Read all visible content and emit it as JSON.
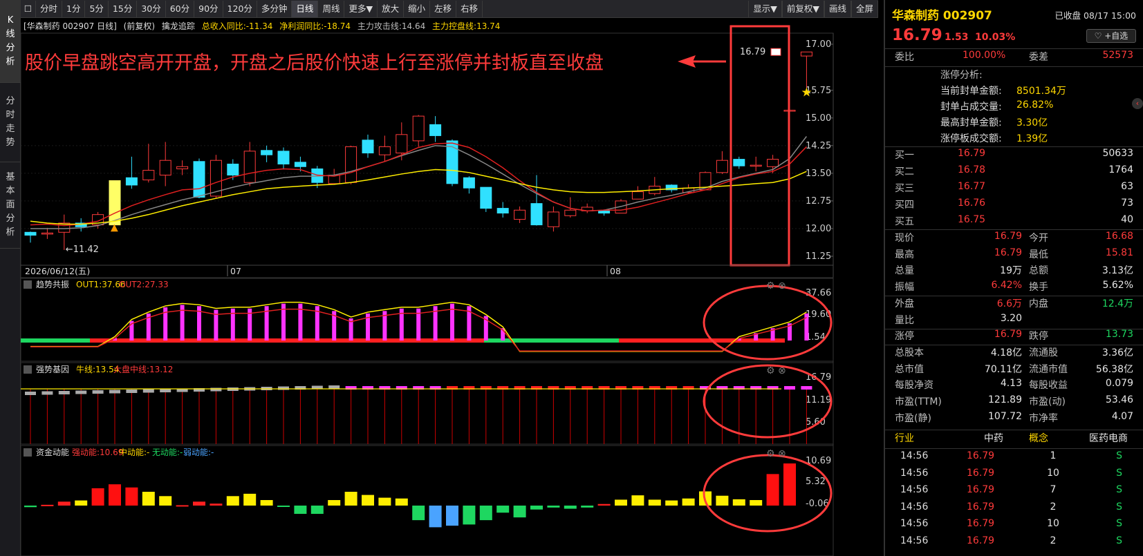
{
  "left_tabs": [
    {
      "chars": [
        "K",
        "线",
        "分",
        "析"
      ],
      "active": true
    },
    {
      "chars": [
        "分",
        "时",
        "走",
        "势"
      ],
      "active": false
    },
    {
      "chars": [
        "基",
        "本",
        "面",
        "分",
        "析"
      ],
      "active": false
    }
  ],
  "toolbar": {
    "left": [
      "分时",
      "1分",
      "5分",
      "15分",
      "30分",
      "60分",
      "90分",
      "120分",
      "多分钟",
      "日线",
      "周线",
      "更多▼",
      "放大",
      "缩小",
      "左移",
      "右移"
    ],
    "active": "日线",
    "right": [
      "显示▼",
      "前复权▼",
      "画线",
      "全屏"
    ]
  },
  "info": {
    "stock": "[华森制药 002907 日线]",
    "adj": "(前复权)",
    "indicator": "擒龙追踪",
    "rev": "总收入同比:-11.34",
    "profit": "净利润同比:-18.74",
    "attack": "主力攻击线:14.64",
    "control": "主力控盘线:13.74"
  },
  "annotation": "股价早盘跳空高开开盘，开盘之后股价快速上行至涨停并封板直至收盘",
  "price_axis": [
    "17.00",
    "15.75",
    "15.00",
    "14.25",
    "13.50",
    "12.75",
    "12.00",
    "11.25"
  ],
  "low_label": "11.42",
  "last_label": "16.79",
  "date_axis": [
    "2026/06/12(五)",
    "07",
    "08"
  ],
  "ind1": {
    "name": "趋势共振",
    "out1": "OUT1:37.66",
    "out2": "OUT2:27.33",
    "axis": [
      "37.66",
      "19.60",
      "1.54"
    ]
  },
  "ind2": {
    "name": "强势基因",
    "line1": "牛线:13.54",
    "line2": "大盘中线:13.12",
    "axis": [
      "16.79",
      "11.19",
      "5.60"
    ]
  },
  "ind3": {
    "name": "资金动能",
    "s": "强动能:10.69",
    "m": "中动能:-",
    "n": "无动能:-",
    "w": "弱动能:-",
    "axis": [
      "10.69",
      "5.32",
      "-0.06"
    ]
  },
  "chart_data": {
    "type": "candlestick",
    "candles": [
      [
        11.9,
        11.82,
        11.92,
        11.62
      ],
      [
        11.85,
        11.88,
        12.02,
        11.72
      ],
      [
        11.9,
        12.15,
        12.38,
        11.42
      ],
      [
        12.15,
        12.05,
        12.28,
        11.92
      ],
      [
        12.1,
        12.38,
        12.45,
        12.0
      ],
      [
        12.1,
        13.3,
        13.3,
        12.1
      ],
      [
        13.38,
        13.18,
        13.95,
        13.08
      ],
      [
        13.32,
        13.58,
        14.3,
        13.25
      ],
      [
        13.45,
        13.85,
        14.35,
        13.15
      ],
      [
        13.62,
        13.68,
        13.85,
        13.45
      ],
      [
        13.82,
        12.85,
        13.9,
        12.82
      ],
      [
        12.88,
        13.85,
        14.0,
        12.82
      ],
      [
        13.75,
        13.45,
        13.88,
        13.32
      ],
      [
        13.25,
        14.1,
        14.35,
        13.15
      ],
      [
        14.12,
        14.0,
        14.25,
        13.8
      ],
      [
        14.1,
        13.75,
        14.2,
        13.6
      ],
      [
        13.8,
        13.68,
        13.95,
        13.55
      ],
      [
        13.62,
        13.25,
        13.7,
        13.1
      ],
      [
        13.22,
        13.45,
        13.62,
        13.2
      ],
      [
        13.25,
        14.22,
        14.25,
        13.2
      ],
      [
        14.4,
        14.05,
        14.55,
        13.92
      ],
      [
        14.0,
        14.22,
        14.52,
        13.82
      ],
      [
        14.05,
        14.55,
        14.88,
        13.85
      ],
      [
        14.38,
        15.05,
        15.08,
        14.22
      ],
      [
        14.82,
        14.52,
        15.05,
        14.35
      ],
      [
        14.38,
        13.22,
        14.42,
        13.15
      ],
      [
        13.38,
        13.1,
        13.42,
        12.95
      ],
      [
        13.12,
        12.55,
        13.12,
        12.45
      ],
      [
        12.55,
        12.42,
        12.72,
        12.3
      ],
      [
        12.25,
        12.5,
        12.6,
        12.15
      ],
      [
        12.68,
        12.1,
        13.45,
        12.08
      ],
      [
        12.05,
        12.45,
        12.6,
        11.92
      ],
      [
        12.35,
        12.5,
        12.85,
        12.3
      ],
      [
        12.48,
        12.58,
        12.68,
        12.42
      ],
      [
        12.48,
        12.42,
        12.52,
        12.35
      ],
      [
        12.42,
        12.75,
        12.8,
        12.42
      ],
      [
        12.8,
        13.0,
        13.15,
        12.8
      ],
      [
        12.95,
        13.15,
        13.4,
        12.9
      ],
      [
        13.18,
        13.05,
        13.2,
        12.98
      ],
      [
        12.98,
        13.1,
        13.2,
        12.95
      ],
      [
        13.05,
        13.52,
        13.55,
        13.05
      ],
      [
        13.52,
        13.85,
        14.1,
        13.48
      ],
      [
        13.88,
        13.7,
        13.95,
        13.62
      ],
      [
        13.72,
        13.72,
        13.95,
        13.55
      ],
      [
        13.68,
        13.88,
        14.0,
        13.5
      ],
      [
        15.21,
        15.21,
        15.21,
        15.21
      ],
      [
        16.68,
        16.79,
        16.79,
        15.81
      ]
    ],
    "ma_red": [
      12.1,
      12.12,
      12.08,
      12.12,
      12.2,
      12.42,
      12.62,
      12.78,
      12.92,
      13.05,
      13.08,
      13.25,
      13.4,
      13.5,
      13.58,
      13.62,
      13.6,
      13.45,
      13.42,
      13.52,
      13.68,
      13.82,
      14.0,
      14.2,
      14.3,
      14.32,
      14.2,
      13.95,
      13.65,
      13.3,
      12.98,
      12.72,
      12.55,
      12.48,
      12.5,
      12.5,
      12.58,
      12.7,
      12.82,
      12.95,
      13.05,
      13.22,
      13.38,
      13.48,
      13.55,
      13.75,
      14.22
    ],
    "ma_grey": [
      12.0,
      12.0,
      12.0,
      12.02,
      12.08,
      12.22,
      12.38,
      12.52,
      12.65,
      12.78,
      12.88,
      13.0,
      13.12,
      13.22,
      13.3,
      13.38,
      13.42,
      13.42,
      13.45,
      13.55,
      13.68,
      13.82,
      13.98,
      14.12,
      14.25,
      14.22,
      14.0,
      13.75,
      13.48,
      13.2,
      12.95,
      12.72,
      12.55,
      12.48,
      12.5,
      12.6,
      12.72,
      12.82,
      12.9,
      13.0,
      13.1,
      13.28,
      13.4,
      13.5,
      13.6,
      13.9,
      14.5
    ],
    "ma_yellow": [
      12.2,
      12.15,
      12.12,
      12.12,
      12.15,
      12.2,
      12.28,
      12.38,
      12.5,
      12.62,
      12.72,
      12.82,
      12.92,
      13.0,
      13.08,
      13.12,
      13.15,
      13.18,
      13.2,
      13.25,
      13.32,
      13.4,
      13.48,
      13.55,
      13.6,
      13.58,
      13.52,
      13.42,
      13.32,
      13.22,
      13.12,
      13.05,
      13.0,
      12.98,
      12.98,
      13.0,
      13.02,
      13.05,
      13.08,
      13.1,
      13.12,
      13.15,
      13.18,
      13.22,
      13.25,
      13.35,
      13.55
    ],
    "ind1_bars": [
      0,
      0,
      0,
      0,
      0,
      2,
      16,
      22,
      27,
      29,
      28,
      25,
      26,
      26,
      28,
      30,
      30,
      28,
      24,
      18,
      22,
      24,
      26,
      26,
      28,
      30,
      28,
      20,
      10,
      0,
      0,
      0,
      0,
      0,
      0,
      0,
      0,
      0,
      0,
      0,
      0,
      0,
      2,
      6,
      10,
      14,
      22,
      32,
      37.66
    ],
    "ind3_bars": [
      -0.4,
      0.2,
      1.0,
      1.3,
      4.4,
      5.4,
      4.6,
      3.5,
      2.4,
      0.1,
      1.0,
      0.5,
      2.4,
      3.0,
      1.4,
      -0.3,
      -2.1,
      -2.1,
      1.4,
      3.5,
      2.7,
      2.0,
      1.8,
      -3.7,
      -5.5,
      -5.1,
      -4.8,
      -3.7,
      -1.8,
      -3.0,
      -1.0,
      -0.5,
      -0.8,
      -0.5,
      0.4,
      1.5,
      2.6,
      1.5,
      1.3,
      1.8,
      3.6,
      2.5,
      1.6,
      1.4,
      8.0,
      10.69
    ]
  },
  "rp": {
    "name": "华森制药 002907",
    "status": "已收盘 08/17 15:00",
    "price": "16.79",
    "chg": "1.53",
    "pct": "10.03%",
    "fav": "♡ +自选",
    "wb_label": "委比",
    "wb": "100.00%",
    "wc_label": "委差",
    "wc": "52573",
    "zt_title": "涨停分析:",
    "zt": [
      [
        "当前封单金额:",
        "8501.34万"
      ],
      [
        "封单占成交量:",
        "26.82%"
      ],
      [
        "最高封单金额:",
        "3.30亿"
      ],
      [
        "涨停板成交额:",
        "1.39亿"
      ]
    ],
    "buys": [
      [
        "买一",
        "16.79",
        "50633"
      ],
      [
        "买二",
        "16.78",
        "1764"
      ],
      [
        "买三",
        "16.77",
        "63"
      ],
      [
        "买四",
        "16.76",
        "73"
      ],
      [
        "买五",
        "16.75",
        "40"
      ]
    ],
    "stats": [
      [
        [
          "现价",
          "16.79",
          "red"
        ],
        [
          "今开",
          "16.68",
          "red"
        ]
      ],
      [
        [
          "最高",
          "16.79",
          "red"
        ],
        [
          "最低",
          "15.81",
          "red"
        ]
      ],
      [
        [
          "总量",
          "19万",
          "white"
        ],
        [
          "总额",
          "3.13亿",
          "white"
        ]
      ],
      [
        [
          "振幅",
          "6.42%",
          "red"
        ],
        [
          "换手",
          "5.62%",
          "white"
        ]
      ],
      [
        [
          "外盘",
          "6.6万",
          "red"
        ],
        [
          "内盘",
          "12.4万",
          "green"
        ]
      ],
      [
        [
          "量比",
          "3.20",
          "white"
        ],
        [
          "",
          "",
          " "
        ]
      ],
      [
        [
          "涨停",
          "16.79",
          "red"
        ],
        [
          "跌停",
          "13.73",
          "green"
        ]
      ],
      [
        [
          "总股本",
          "4.18亿",
          "white"
        ],
        [
          "流通股",
          "3.36亿",
          "white"
        ]
      ],
      [
        [
          "总市值",
          "70.11亿",
          "white"
        ],
        [
          "流通市值",
          "56.38亿",
          "white"
        ]
      ],
      [
        [
          "每股净资",
          "4.13",
          "white"
        ],
        [
          "每股收益",
          "0.079",
          "white"
        ]
      ],
      [
        [
          "市盈(TTM)",
          "121.89",
          "white"
        ],
        [
          "市盈(动)",
          "53.46",
          "white"
        ]
      ],
      [
        [
          "市盈(静)",
          "107.72",
          "white"
        ],
        [
          "市净率",
          "4.07",
          "white"
        ]
      ]
    ],
    "industry": [
      "行业",
      "中药",
      "概念",
      "医药电商"
    ],
    "trades": [
      [
        "14:56",
        "16.79",
        "1",
        "S"
      ],
      [
        "14:56",
        "16.79",
        "10",
        "S"
      ],
      [
        "14:56",
        "16.79",
        "7",
        "S"
      ],
      [
        "14:56",
        "16.79",
        "2",
        "S"
      ],
      [
        "14:56",
        "16.79",
        "10",
        "S"
      ],
      [
        "14:56",
        "16.79",
        "2",
        "S"
      ]
    ]
  }
}
